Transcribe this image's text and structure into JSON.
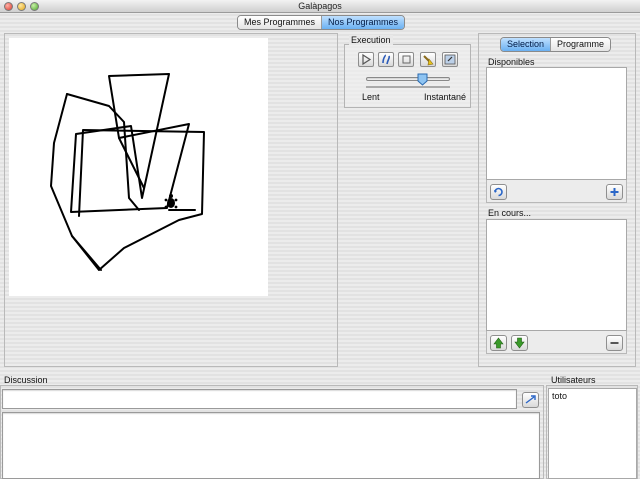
{
  "window": {
    "title": "Galàpagos"
  },
  "top_tabs": [
    {
      "label": "Mes Programmes",
      "selected": false
    },
    {
      "label": "Nos Programmes",
      "selected": true
    }
  ],
  "execution": {
    "label": "Execution",
    "tools": [
      "play-icon",
      "step-icon",
      "stop-icon",
      "clean-icon",
      "turtle-reset-icon"
    ],
    "speed": {
      "min_label": "Lent",
      "max_label": "Instantané",
      "value": 0.7
    }
  },
  "right_tabs": [
    {
      "label": "Selection",
      "selected": true
    },
    {
      "label": "Programme",
      "selected": false
    }
  ],
  "disponibles": {
    "label": "Disponibles",
    "items": []
  },
  "en_cours": {
    "label": "En cours...",
    "items": []
  },
  "discussion": {
    "label": "Discussion",
    "input_value": "",
    "log": ""
  },
  "utilisateurs": {
    "label": "Utilisateurs",
    "users": [
      "toto"
    ]
  },
  "colors": {
    "selected_tab": "#6ab0f2",
    "turtle_ink": "#000000",
    "canvas": "#ffffff",
    "add_button": "#2a66c8",
    "arrow_button": "#3a9a2a"
  }
}
